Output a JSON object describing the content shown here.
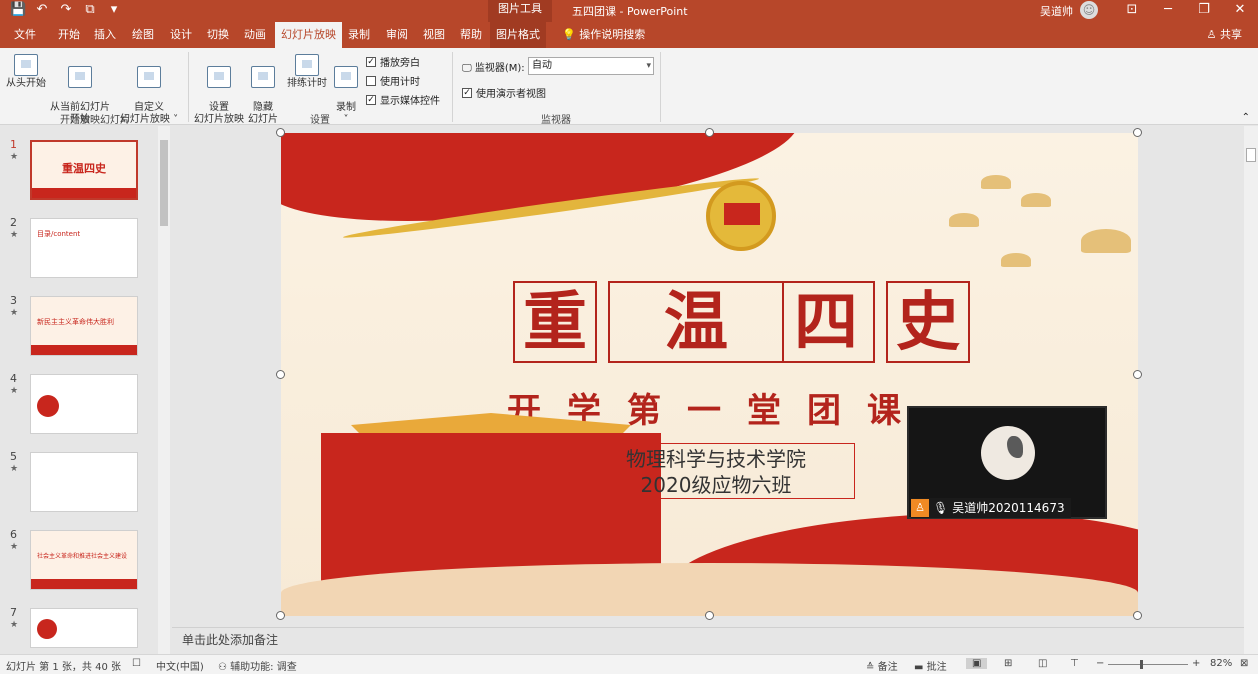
{
  "titlebar": {
    "context_tool": "图片工具",
    "doc_title": "五四团课 - PowerPoint",
    "user_name": "吴道帅",
    "qat": [
      "💾",
      "↶",
      "↷",
      "⧉",
      "▾"
    ],
    "win_buttons": [
      "⊡",
      "─",
      "❐",
      "✕"
    ]
  },
  "tabs": [
    {
      "label": "文件"
    },
    {
      "label": "开始"
    },
    {
      "label": "插入"
    },
    {
      "label": "绘图"
    },
    {
      "label": "设计"
    },
    {
      "label": "切换"
    },
    {
      "label": "动画"
    },
    {
      "label": "幻灯片放映"
    },
    {
      "label": "录制"
    },
    {
      "label": "审阅"
    },
    {
      "label": "视图"
    },
    {
      "label": "帮助"
    },
    {
      "label": "图片格式"
    },
    {
      "label": "操作说明搜索"
    }
  ],
  "share_label": "共享",
  "ribbon": {
    "from_beginning": "从头开始",
    "from_current": "从当前幻灯片\n开始",
    "custom_show": "自定义\n幻灯片放映 ˅",
    "group_start": "开始放映幻灯片",
    "setup_show": "设置\n幻灯片放映",
    "hide_slide": "隐藏\n幻灯片",
    "rehearse": "排练计时",
    "record": "录制\n˅",
    "play_narration": "播放旁白",
    "use_timings": "使用计时",
    "show_media": "显示媒体控件",
    "group_setup": "设置",
    "monitor_label": "监视器(M):",
    "monitor_value": "自动",
    "presenter_view": "使用演示者视图",
    "group_monitor": "监视器"
  },
  "slides": [
    {
      "num": "1",
      "text": "重温四史"
    },
    {
      "num": "2",
      "text": "目录/content"
    },
    {
      "num": "3",
      "text": "新民主主义革命伟大胜利"
    },
    {
      "num": "4",
      "text": ""
    },
    {
      "num": "5",
      "text": ""
    },
    {
      "num": "6",
      "text": "社会主义革命和推进社会主义建设"
    },
    {
      "num": "7",
      "text": ""
    }
  ],
  "slide": {
    "title_chars": [
      "重",
      "温",
      "四",
      "史"
    ],
    "subtitle": "开学第一堂团课",
    "dept": "物理科学与技术学院",
    "class": "2020级应物六班"
  },
  "video": {
    "user_label": "吴道帅2020114673"
  },
  "notes_placeholder": "单击此处添加备注",
  "status": {
    "slide_count": "幻灯片 第 1 张，共 40 张",
    "language": "中文(中国)",
    "accessibility": "辅助功能: 调查",
    "notes": "备注",
    "comments": "批注",
    "zoom": "82%"
  },
  "colors": {
    "ppt_accent": "#b7472a",
    "slide_red": "#c8261d"
  }
}
